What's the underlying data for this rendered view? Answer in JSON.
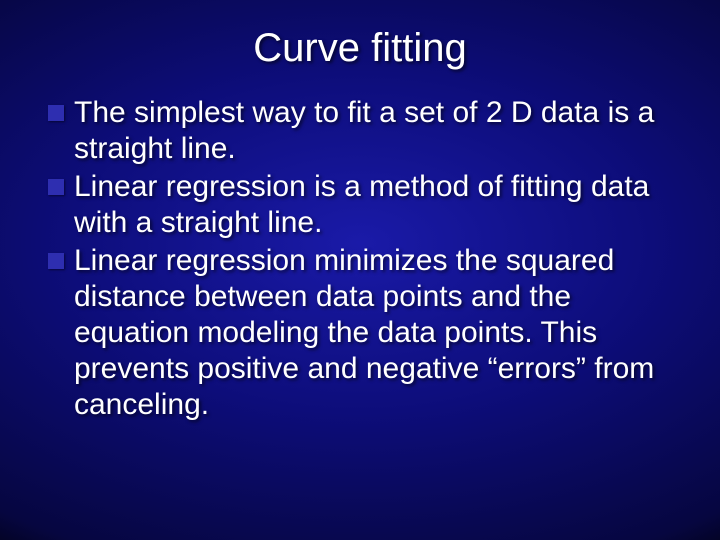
{
  "slide": {
    "title": "Curve fitting",
    "bullets": [
      "The simplest way to fit a set of 2 D data is a straight line.",
      "Linear regression is a method of fitting data with a straight line.",
      "Linear regression minimizes the squared distance between data points and the equation modeling the data points. This prevents positive and negative “errors” from canceling."
    ]
  }
}
